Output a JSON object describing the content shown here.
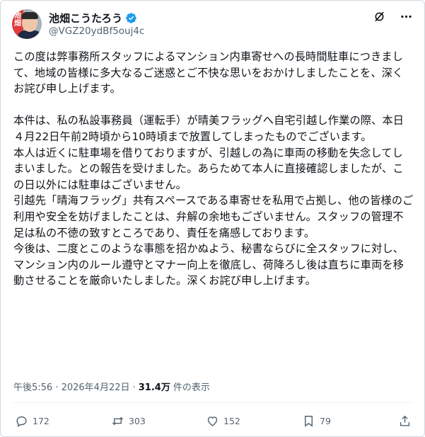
{
  "author": {
    "display_name": "池畑こうたろう",
    "handle": "@VGZ20ydBf5ouj4c",
    "avatar_text": "池\n畑"
  },
  "post": {
    "text": "この度は弊事務所スタッフによるマンション内車寄せへの長時間駐車につきまして、地域の皆様に多大なるご迷惑とご不快な思いをおかけしましたことを、深くお詫び申し上げます。\n\n本件は、私の私設事務員（運転手）が晴美フラッグへ自宅引越し作業の際、本日４月22日午前2時頃から10時頃まで放置してしまったものでございます。\n本人は近くに駐車場を借りておりますが、引越しの為に車両の移動を失念してしまいました。との報告を受けました。あらためて本人に直接確認しましたが、この日以外には駐車はございません。\n引越先「晴海フラッグ」共有スペースである車寄せを私用で占拠し、他の皆様のご利用や安全を妨げましたことは、弁解の余地もございません。スタッフの管理不足は私の不徳の致すところであり、責任を痛感しております。\n今後は、二度とこのような事態を招かぬよう、秘書ならびに全スタッフに対し、マンション内のルール遵守とマナー向上を徹底し、荷降ろし後は直ちに車両を移動させることを厳命いたしました。深くお詫び申し上げます。",
    "timestamp": "午後5:56 · 2026年4月22日 ·",
    "views_count": "31.4万",
    "views_label": "件の表示"
  },
  "stats": {
    "replies": "172",
    "reposts": "303",
    "likes": "152",
    "bookmarks": "79"
  },
  "icons": {
    "verified": "verified-badge-icon",
    "grok": "grok-icon",
    "more": "more-icon",
    "reply": "reply-icon",
    "repost": "repost-icon",
    "like": "heart-icon",
    "bookmark": "bookmark-icon",
    "share": "share-icon"
  },
  "colors": {
    "verified": "#1d9bf0",
    "text_primary": "#0f1419",
    "text_secondary": "#536471"
  }
}
